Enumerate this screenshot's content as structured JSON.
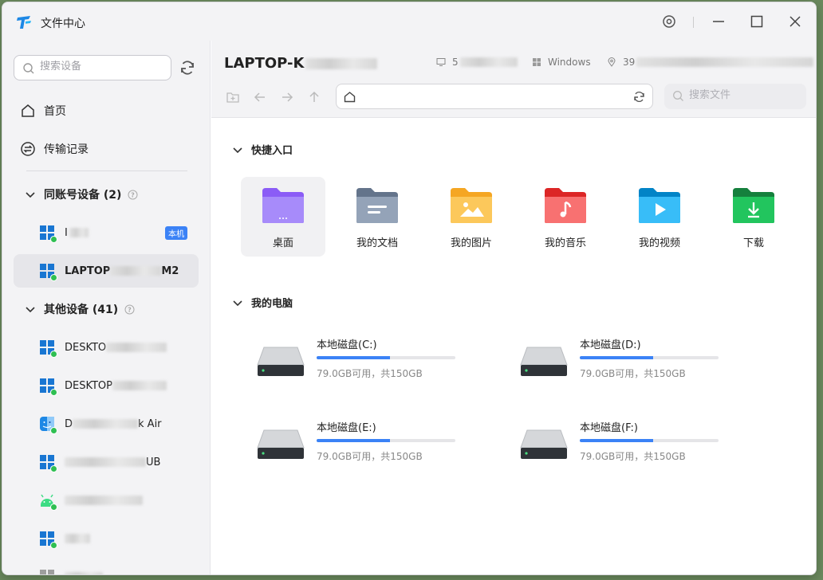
{
  "window": {
    "title": "文件中心"
  },
  "colors": {
    "accent": "#3b82f6",
    "online": "#2fbf52"
  },
  "sidebar": {
    "search_placeholder": "搜索设备",
    "home_label": "首页",
    "transfer_label": "传输记录",
    "group_same": "同账号设备 (2)",
    "group_other": "其他设备 (41)",
    "local_badge": "本机",
    "devices_same": [
      {
        "label": "I",
        "os": "windows"
      },
      {
        "label_start": "LAPTOP",
        "label_end": "M2",
        "os": "windows"
      }
    ],
    "devices_other": [
      {
        "label_start": "DESKTO",
        "label_end": "",
        "os": "windows"
      },
      {
        "label_start": "DESKTOP",
        "label_end": "",
        "os": "windows"
      },
      {
        "label_start": "D",
        "label_end": "k Air",
        "os": "mac"
      },
      {
        "label_start": "",
        "label_end": "UB",
        "os": "windows"
      },
      {
        "label_start": "",
        "label_end": "",
        "os": "android"
      },
      {
        "label_start": "",
        "label_end": "",
        "os": "windows"
      }
    ]
  },
  "main": {
    "device_title": "LAPTOP-K",
    "info_model": "5",
    "info_os": "Windows",
    "info_location": "39",
    "file_search_placeholder": "搜索文件",
    "quick_title": "快捷入口",
    "quick_items": [
      {
        "label": "桌面",
        "icon": "desktop-folder-icon",
        "color": "#8b5cf6"
      },
      {
        "label": "我的文档",
        "icon": "documents-folder-icon",
        "color": "#64748b"
      },
      {
        "label": "我的图片",
        "icon": "pictures-folder-icon",
        "color": "#f5b82e"
      },
      {
        "label": "我的音乐",
        "icon": "music-folder-icon",
        "color": "#ef4444"
      },
      {
        "label": "我的视频",
        "icon": "videos-folder-icon",
        "color": "#1aa5f0"
      },
      {
        "label": "下载",
        "icon": "downloads-folder-icon",
        "color": "#16a34a"
      }
    ],
    "pc_title": "我的电脑",
    "disks": [
      {
        "name": "本地磁盘(C:)",
        "capacity": "79.0GB可用，共150GB",
        "used_fraction": 0.527
      },
      {
        "name": "本地磁盘(D:)",
        "capacity": "79.0GB可用，共150GB",
        "used_fraction": 0.527
      },
      {
        "name": "本地磁盘(E:)",
        "capacity": "79.0GB可用，共150GB",
        "used_fraction": 0.527
      },
      {
        "name": "本地磁盘(F:)",
        "capacity": "79.0GB可用，共150GB",
        "used_fraction": 0.527
      }
    ]
  }
}
